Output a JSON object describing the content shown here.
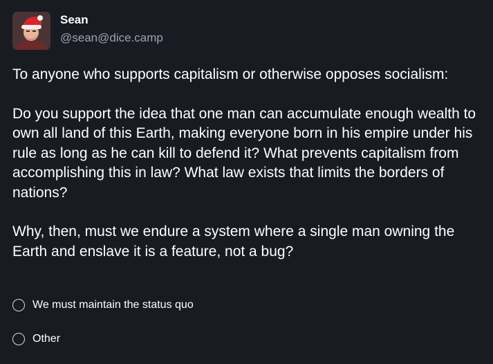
{
  "author": {
    "display_name": "Sean",
    "handle": "@sean@dice.camp",
    "avatar_icon": "santa-hat-avatar-icon"
  },
  "content": {
    "paragraphs": [
      "To anyone who supports capitalism or otherwise opposes socialism:",
      "Do you support the idea that one man can accumulate enough wealth to own all land of this Earth, making everyone born in his empire under his rule as long as he can kill to defend it? What prevents capitalism from accomplishing this in law? What law exists that limits the borders of nations?",
      "Why, then, must we endure a system where a single man owning the Earth and enslave it is a feature, not a bug?"
    ]
  },
  "poll": {
    "options": [
      {
        "label": "We must maintain the status quo"
      },
      {
        "label": "Other"
      }
    ]
  },
  "colors": {
    "background": "#191b22",
    "text": "#ffffff",
    "handle": "#9ba1b7",
    "radio_border": "#d9dbe3"
  }
}
